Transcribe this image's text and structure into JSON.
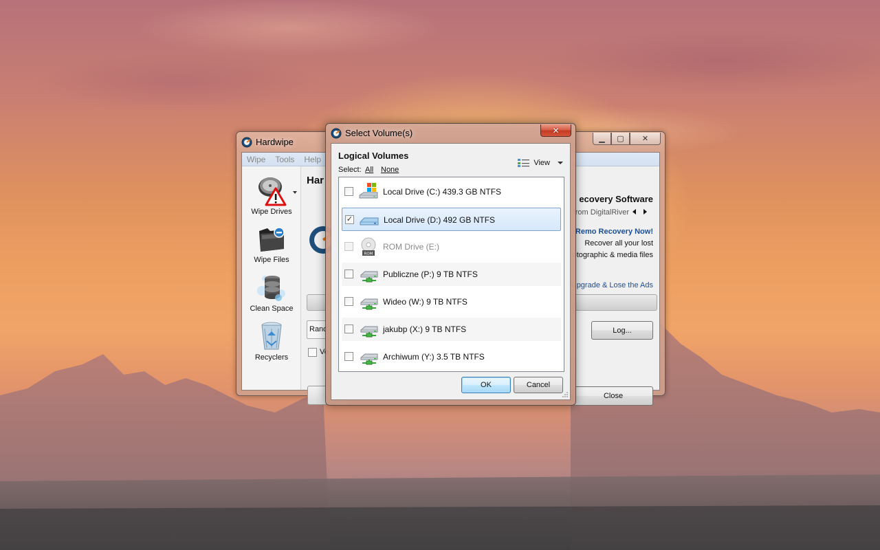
{
  "hardwipe": {
    "title": "Hardwipe",
    "menu": [
      "Wipe",
      "Tools",
      "Help"
    ],
    "sidebar": [
      {
        "label": "Wipe Drives"
      },
      {
        "label": "Wipe Files"
      },
      {
        "label": "Clean Space"
      },
      {
        "label": "Recyclers"
      }
    ],
    "heading": "Har",
    "method_value": "Rand",
    "verify_label": "Ve",
    "ad": {
      "title": "ecovery Software",
      "subtitle": "from DigitalRiver",
      "cta": "Remo Recovery Now!",
      "line1": "Recover all your lost",
      "line2": "otographic & media files",
      "upgrade": "Upgrade & Lose the Ads"
    },
    "log_button": "Log...",
    "close_button": "Close"
  },
  "dialog": {
    "title": "Select Volume(s)",
    "close_glyph": "✕",
    "heading": "Logical Volumes",
    "select_label": "Select:",
    "select_all": "All",
    "select_none": "None",
    "view_label": "View",
    "volumes": [
      {
        "label": "Local Drive (C:) 439.3 GB NTFS",
        "checked": false,
        "enabled": true,
        "icon": "system-drive-icon"
      },
      {
        "label": "Local Drive (D:) 492 GB NTFS",
        "checked": true,
        "enabled": true,
        "icon": "local-drive-icon"
      },
      {
        "label": "ROM Drive (E:)",
        "checked": false,
        "enabled": false,
        "icon": "rom-drive-icon"
      },
      {
        "label": "Publiczne (P:) 9 TB NTFS",
        "checked": false,
        "enabled": true,
        "icon": "network-drive-icon"
      },
      {
        "label": "Wideo (W:) 9 TB NTFS",
        "checked": false,
        "enabled": true,
        "icon": "network-drive-icon"
      },
      {
        "label": "jakubp (X:) 9 TB NTFS",
        "checked": false,
        "enabled": true,
        "icon": "network-drive-icon"
      },
      {
        "label": "Archiwum (Y:) 3.5 TB NTFS",
        "checked": false,
        "enabled": true,
        "icon": "network-drive-icon"
      }
    ],
    "ok_button": "OK",
    "cancel_button": "Cancel"
  },
  "colors": {
    "selection_bg": "#d6e8fb",
    "selection_border": "#7da2ce",
    "link_blue": "#1b4f93",
    "close_red": "#c43b22"
  }
}
